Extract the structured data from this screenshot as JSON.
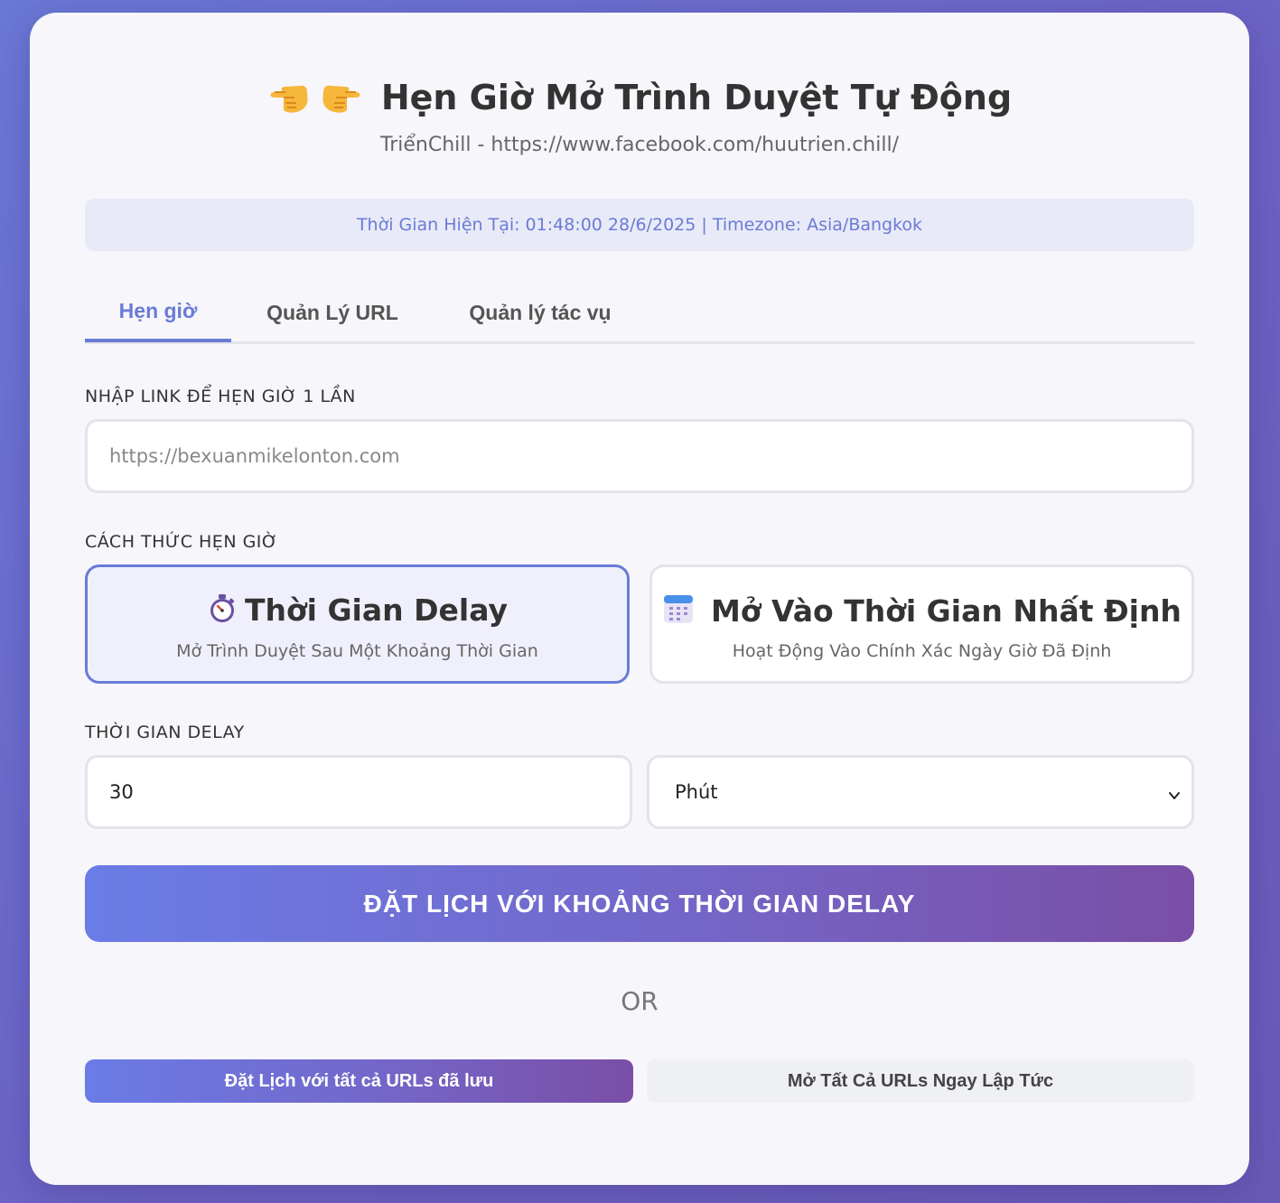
{
  "header": {
    "title": "Hẹn Giờ Mở Trình Duyệt Tự Động",
    "subtitle": "TriểnChill - https://www.facebook.com/huutrien.chill/",
    "icons": [
      "pointing-left-hand-icon",
      "pointing-right-hand-icon"
    ]
  },
  "status": {
    "current_time_text": "Thời Gian Hiện Tại: 01:48:00 28/6/2025 | Timezone: Asia/Bangkok"
  },
  "tabs": [
    {
      "label": "Hẹn giờ",
      "active": true
    },
    {
      "label": "Quản Lý URL",
      "active": false
    },
    {
      "label": "Quản lý tác vụ",
      "active": false
    }
  ],
  "form": {
    "url_label": "NHẬP LINK ĐỂ HẸN GIỜ 1 LẦN",
    "url_placeholder": "https://bexuanmikelonton.com",
    "url_value": "",
    "method_label": "CÁCH THỨC HẸN GIỜ",
    "methods": [
      {
        "icon": "stopwatch-icon",
        "title": "Thời Gian Delay",
        "desc": "Mở Trình Duyệt Sau Một Khoảng Thời Gian",
        "active": true
      },
      {
        "icon": "calendar-icon",
        "title": "Mở Vào Thời Gian Nhất Định",
        "desc": "Hoạt Động Vào Chính Xác Ngày Giờ Đã Định",
        "active": false
      }
    ],
    "delay_label": "THỜI GIAN DELAY",
    "delay_value": "30",
    "unit_selected": "Phút"
  },
  "actions": {
    "schedule_delay_button": "ĐẶT LỊCH VỚI KHOẢNG THỜI GIAN DELAY",
    "or_text": "OR",
    "schedule_all_button": "Đặt Lịch với tất cả URLs đã lưu",
    "open_all_button": "Mở Tất Cả URLs Ngay Lập Tức"
  },
  "colors": {
    "accent": "#6a7bd6",
    "gradient_start": "#6a7ce6",
    "gradient_end": "#7a4ea6",
    "background": "#6d62c4",
    "card": "#f6f6fb"
  }
}
